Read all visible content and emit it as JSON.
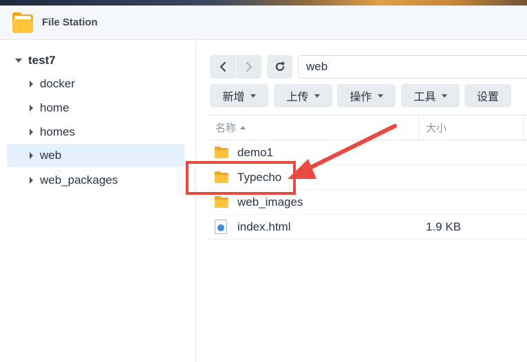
{
  "app": {
    "title": "File Station",
    "icon": "folder-app-icon"
  },
  "sidebar": {
    "root": {
      "label": "test7",
      "expanded": true
    },
    "items": [
      {
        "label": "docker",
        "selected": false
      },
      {
        "label": "home",
        "selected": false
      },
      {
        "label": "homes",
        "selected": false
      },
      {
        "label": "web",
        "selected": true
      },
      {
        "label": "web_packages",
        "selected": false
      }
    ]
  },
  "nav": {
    "path": "web"
  },
  "toolbar": {
    "create_label": "新增",
    "upload_label": "上传",
    "action_label": "操作",
    "tools_label": "工具",
    "settings_label": "设置"
  },
  "table": {
    "columns": {
      "name": "名称",
      "size": "大小"
    },
    "rows": [
      {
        "name": "demo1",
        "size": "",
        "type": "folder"
      },
      {
        "name": "Typecho",
        "size": "",
        "type": "folder"
      },
      {
        "name": "web_images",
        "size": "",
        "type": "folder"
      },
      {
        "name": "index.html",
        "size": "1.9 KB",
        "type": "html-file"
      }
    ]
  },
  "annotation": {
    "color": "#e94a3f",
    "target": "Typecho"
  },
  "colors": {
    "selected_bg": "#e4f0fc",
    "button_bg": "#e8ebef",
    "folder": "#ffc43a"
  }
}
